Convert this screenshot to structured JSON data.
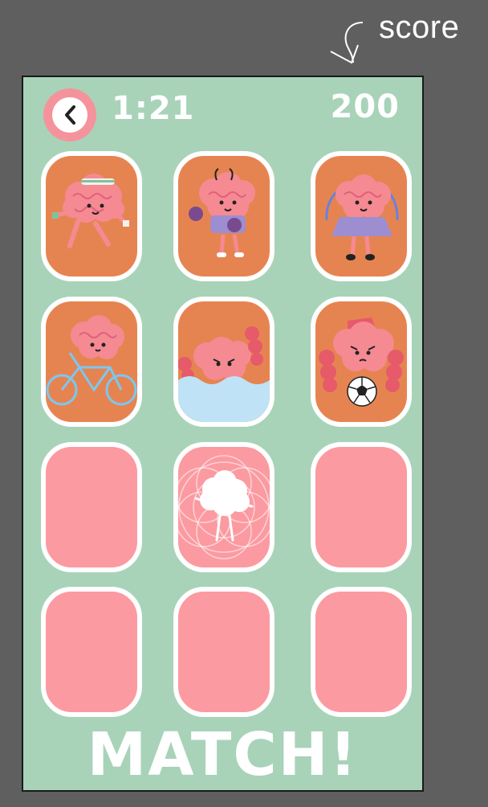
{
  "annotation": {
    "label": "score"
  },
  "hud": {
    "timer": "1:21",
    "score": "200"
  },
  "title": "MATCH!",
  "cards": [
    {
      "state": "revealed",
      "character": "brain-jogging"
    },
    {
      "state": "revealed",
      "character": "brain-boxing"
    },
    {
      "state": "revealed",
      "character": "brain-jump-rope"
    },
    {
      "state": "revealed",
      "character": "brain-cycling"
    },
    {
      "state": "revealed",
      "character": "brain-swimming"
    },
    {
      "state": "revealed",
      "character": "brain-soccer"
    },
    {
      "state": "hidden"
    },
    {
      "state": "selected"
    },
    {
      "state": "hidden"
    },
    {
      "state": "hidden"
    },
    {
      "state": "hidden"
    },
    {
      "state": "hidden"
    }
  ],
  "colors": {
    "background": "#a8d3b9",
    "card_face": "#e68451",
    "card_back": "#fb9aa1",
    "brain": "#f58a93"
  }
}
